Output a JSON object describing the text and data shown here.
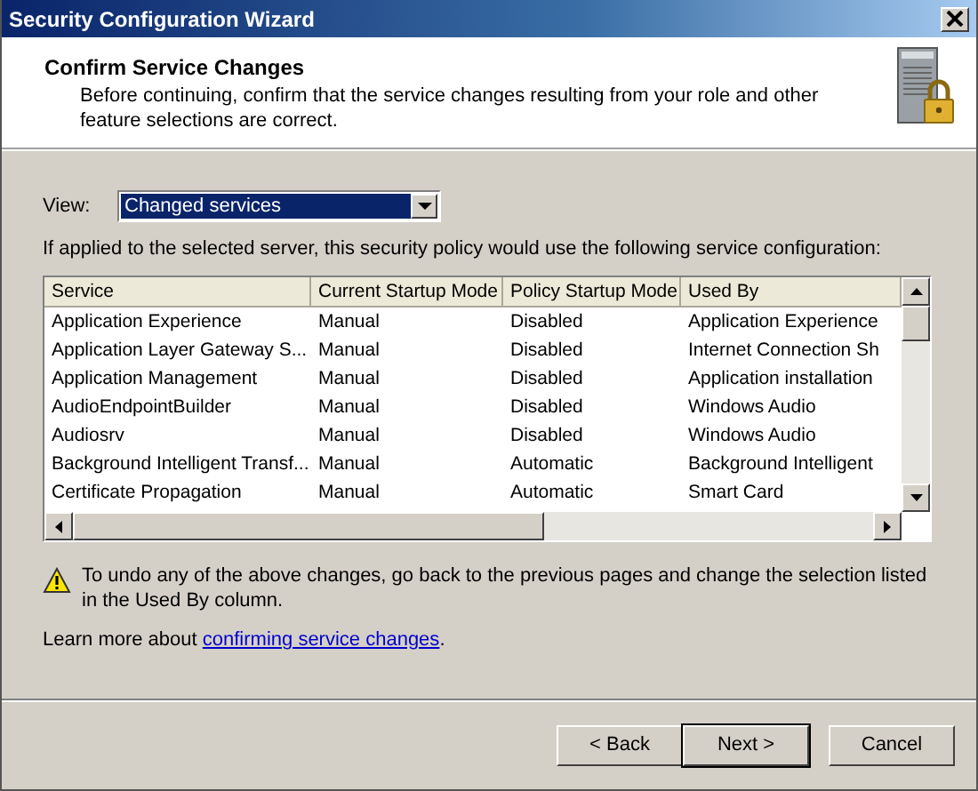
{
  "window": {
    "title": "Security Configuration Wizard"
  },
  "header": {
    "title": "Confirm Service Changes",
    "description": "Before continuing, confirm that the service changes resulting from your role and other feature selections are correct."
  },
  "view": {
    "label": "View:",
    "value": "Changed services"
  },
  "intro": "If applied to the selected server, this security policy would use the following service configuration:",
  "table": {
    "columns": [
      "Service",
      "Current Startup Mode",
      "Policy Startup Mode",
      "Used By"
    ],
    "rows": [
      [
        "Application Experience",
        "Manual",
        "Disabled",
        "Application Experience"
      ],
      [
        "Application Layer Gateway S...",
        "Manual",
        "Disabled",
        "Internet Connection Sh"
      ],
      [
        "Application Management",
        "Manual",
        "Disabled",
        "Application installation"
      ],
      [
        "AudioEndpointBuilder",
        "Manual",
        "Disabled",
        "Windows Audio"
      ],
      [
        "Audiosrv",
        "Manual",
        "Disabled",
        "Windows Audio"
      ],
      [
        "Background Intelligent Transf...",
        "Manual",
        "Automatic",
        "Background Intelligent"
      ],
      [
        "Certificate Propagation",
        "Manual",
        "Automatic",
        "Smart Card"
      ]
    ]
  },
  "warning": "To undo any of the above changes, go back to the previous pages and change the selection listed in the Used By column.",
  "learn_more": {
    "text": "Learn more about ",
    "link": "confirming service changes",
    "suffix": "."
  },
  "buttons": [
    {
      "label": "< Back",
      "default": false
    },
    {
      "label": "Next >",
      "default": true
    },
    {
      "label": "Cancel",
      "default": false
    }
  ]
}
